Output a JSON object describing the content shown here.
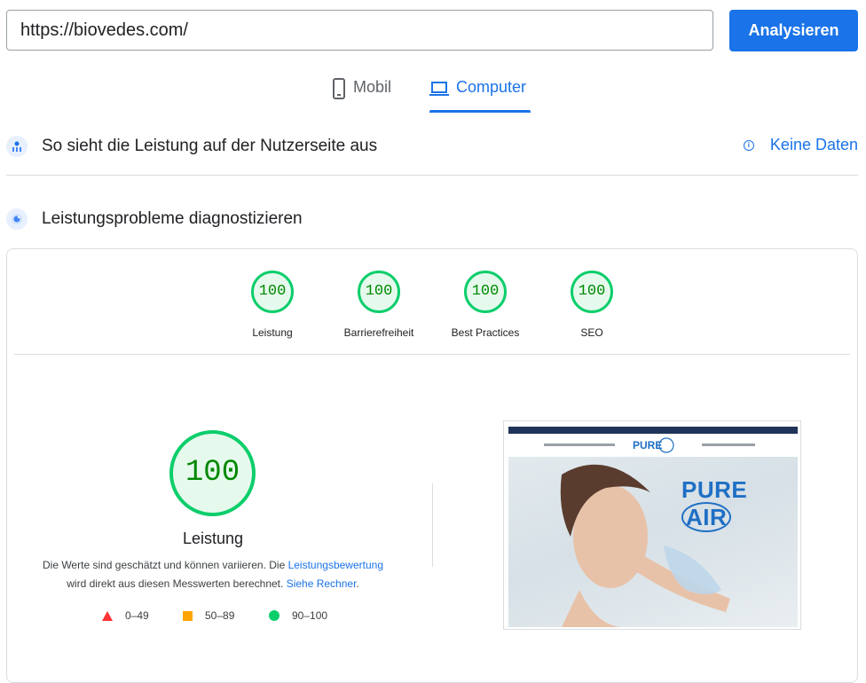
{
  "search": {
    "url": "https://biovedes.com/",
    "button_label": "Analysieren"
  },
  "tabs": [
    {
      "label": "Mobil",
      "icon": "phone-icon",
      "active": false
    },
    {
      "label": "Computer",
      "icon": "laptop-icon",
      "active": true
    }
  ],
  "field_section": {
    "title": "So sieht die Leistung auf der Nutzerseite aus",
    "status": "Keine Daten",
    "icon": "field-data-icon"
  },
  "lab_section": {
    "title": "Leistungsprobleme diagnostizieren",
    "icon": "lab-data-icon"
  },
  "scores": [
    {
      "value": "100",
      "label": "Leistung"
    },
    {
      "value": "100",
      "label": "Barrierefreiheit"
    },
    {
      "value": "100",
      "label": "Best Practices"
    },
    {
      "value": "100",
      "label": "SEO"
    }
  ],
  "performance": {
    "score": "100",
    "label": "Leistung",
    "desc_part1": "Die Werte sind geschätzt und können variieren. Die ",
    "desc_link1": "Leistungsbewertung",
    "desc_part2": " wird direkt aus diesen Messwerten berechnet. ",
    "desc_link2": "Siehe Rechner",
    "desc_part3": "."
  },
  "legend": [
    {
      "range": "0–49",
      "color": "#ff3333",
      "shape": "triangle"
    },
    {
      "range": "50–89",
      "color": "#ffa400",
      "shape": "square"
    },
    {
      "range": "90–100",
      "color": "#0cce6b",
      "shape": "circle"
    }
  ],
  "colors": {
    "accent": "#1a73e8",
    "pass": "#0cce6b",
    "pass_text": "#008800"
  }
}
